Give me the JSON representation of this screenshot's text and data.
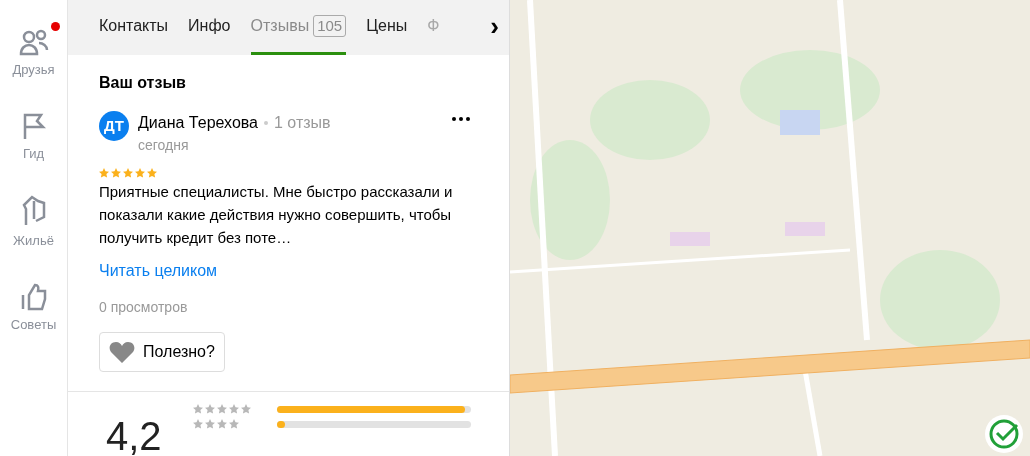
{
  "sidebar": {
    "items": [
      {
        "label": "Друзья",
        "kind": "friends",
        "badge": true
      },
      {
        "label": "Гид",
        "kind": "guide",
        "badge": false
      },
      {
        "label": "Жильё",
        "kind": "housing",
        "badge": false
      },
      {
        "label": "Советы",
        "kind": "tips",
        "badge": false
      }
    ]
  },
  "tabs": [
    {
      "label": "Контакты",
      "selected": false
    },
    {
      "label": "Инфо",
      "selected": false
    },
    {
      "label": "Отзывы",
      "count": "105",
      "selected": true
    },
    {
      "label": "Цены",
      "selected": false
    },
    {
      "label": "Ф",
      "selected": false,
      "faded": true
    }
  ],
  "tabs_next": "›",
  "my_review": {
    "heading": "Ваш отзыв",
    "avatar": "ДТ",
    "author": "Диана Терехова",
    "author_reviews": "1 отзыв",
    "date": "сегодня",
    "stars": 5,
    "text": "Приятные специалисты. Мне быстро рассказали и показали какие действия нужно совершить, чтобы получить кредит без поте…",
    "read_more": "Читать целиком",
    "views": "0 просмотров",
    "helpful": "Полезно?"
  },
  "rating": {
    "score": "4,2",
    "bars": [
      {
        "level": 0.97
      },
      {
        "level": 0.04
      }
    ]
  }
}
